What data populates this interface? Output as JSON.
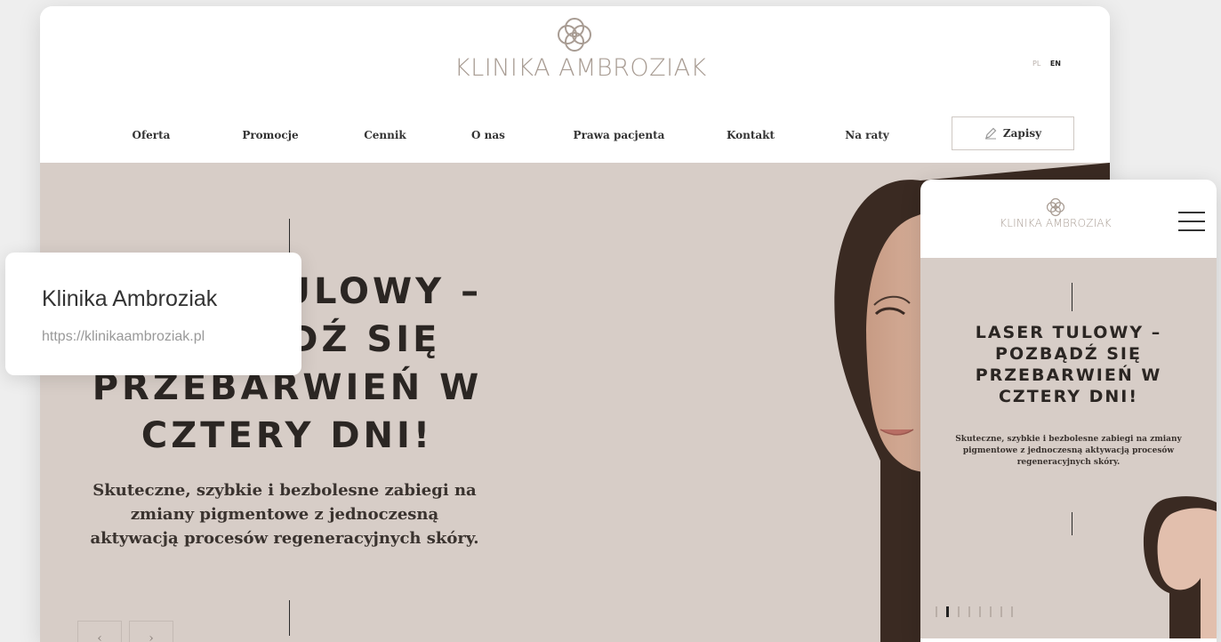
{
  "site": {
    "brand": "KLINIKA AMBROZIAK",
    "lang": [
      "PL",
      "EN"
    ],
    "active_lang": "EN"
  },
  "nav": {
    "items": [
      "Oferta",
      "Promocje",
      "Cennik",
      "O nas",
      "Prawa pacjenta",
      "Kontakt",
      "Na raty"
    ],
    "cta": "Zapisy"
  },
  "hero": {
    "title": "LASER TULOWY – POZBĄDŹ SIĘ PRZEBARWIEŃ W CZTERY DNI!",
    "subtitle": "Skuteczne, szybkie i bezbolesne zabiegi na zmiany pigmentowe z jednoczesną aktywacją procesów regeneracyjnych skóry.",
    "prev": "‹",
    "next": "›"
  },
  "tooltip": {
    "title": "Klinika Ambroziak",
    "url": "https://klinikaambroziak.pl"
  },
  "mobile": {
    "brand": "KLINIKA AMBROZIAK",
    "title": "LASER TULOWY – POZBĄDŹ SIĘ PRZEBARWIEŃ W CZTERY DNI!",
    "subtitle": "Skuteczne, szybkie i bezbolesne zabiegi na zmiany pigmentowe z jednoczesną aktywacją procesów regeneracyjnych skóry.",
    "slides": 8,
    "active_slide": 2
  },
  "colors": {
    "hero_bg": "#d7cdc7",
    "logo": "#a89c93",
    "text_dark": "#2b2623"
  },
  "icons": [
    "logo-rings-icon",
    "pencil-icon",
    "hamburger-menu-icon",
    "chevron-left-icon",
    "chevron-right-icon"
  ]
}
